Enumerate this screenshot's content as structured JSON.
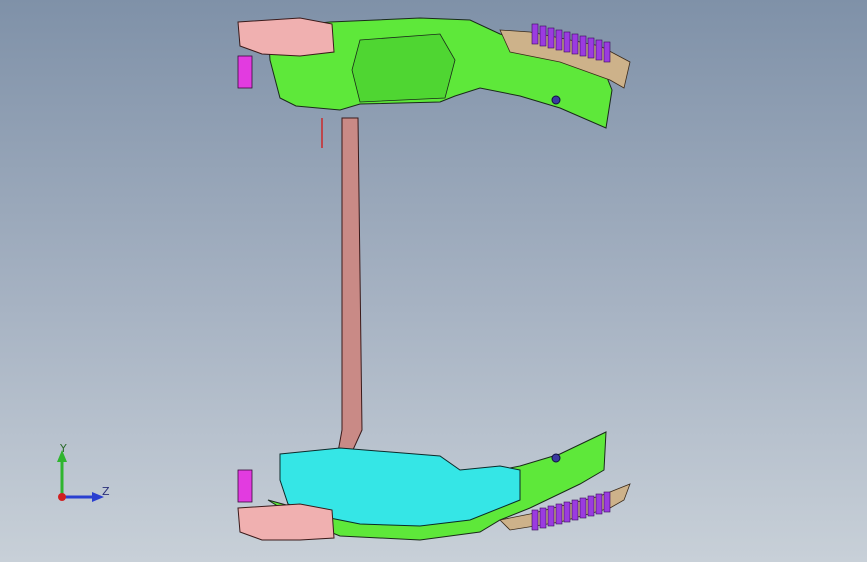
{
  "viewport": {
    "background_top": "#7f91a8",
    "background_bottom": "#c8d0d8"
  },
  "model": {
    "colors": {
      "frame_green": "#5ee83a",
      "frame_cyan": "#35e6e6",
      "pillar": "#c98a86",
      "tan_trim": "#cdb28a",
      "purple_ribs": "#9b3be0",
      "magenta_bracket": "#e23be0",
      "pink_mount": "#f0b0b0",
      "edge": "#1a2a1a"
    }
  },
  "triad": {
    "y_label": "Y",
    "z_label": "Z",
    "y_color": "#2fb52f",
    "z_color": "#2a3fd0",
    "x_color": "#d02020"
  }
}
